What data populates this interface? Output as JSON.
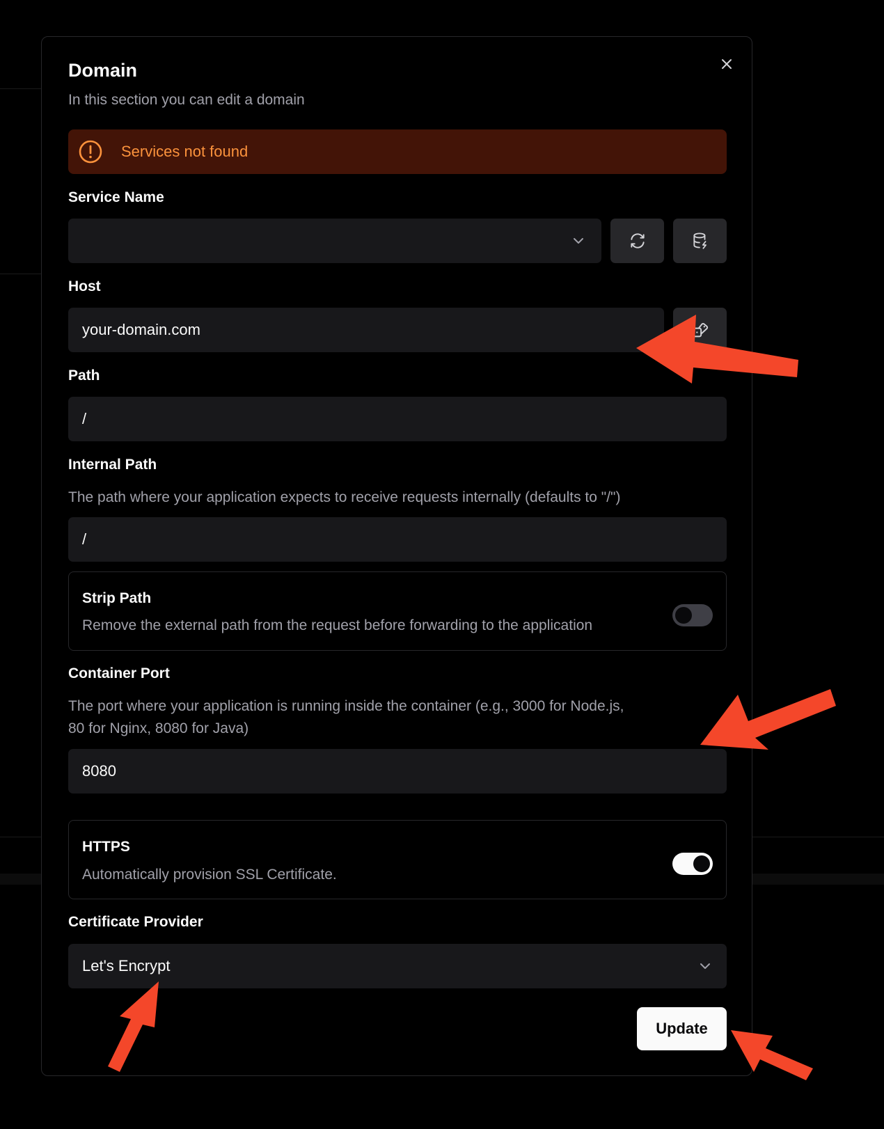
{
  "dialog": {
    "title": "Domain",
    "subtitle": "In this section you can edit a domain",
    "close_icon": "close-icon"
  },
  "alert": {
    "text": "Services not found",
    "icon": "alert-circle-icon",
    "color": "#fb923c",
    "background": "#431407"
  },
  "service_name": {
    "label": "Service Name",
    "value": "",
    "refresh_icon": "refresh-icon",
    "database_icon": "database-icon"
  },
  "host": {
    "label": "Host",
    "value": "your-domain.com",
    "dice_icon": "dice-icon"
  },
  "path": {
    "label": "Path",
    "value": "/"
  },
  "internal_path": {
    "label": "Internal Path",
    "description": "The path where your application expects to receive requests internally (defaults to \"/\")",
    "value": "/"
  },
  "strip_path": {
    "label": "Strip Path",
    "description": "Remove the external path from the request before forwarding to the application",
    "enabled": false
  },
  "container_port": {
    "label": "Container Port",
    "description_line1": "The port where your application is running inside the container (e.g., 3000 for Node.js,",
    "description_line2": "80 for Nginx, 8080 for Java)",
    "value": "8080"
  },
  "https": {
    "label": "HTTPS",
    "description": "Automatically provision SSL Certificate.",
    "enabled": true
  },
  "certificate_provider": {
    "label": "Certificate Provider",
    "value": "Let's Encrypt"
  },
  "actions": {
    "update_label": "Update"
  },
  "colors": {
    "annotation_arrow": "#f4472a",
    "accent": "#fafafa",
    "field_bg": "#18181b"
  }
}
